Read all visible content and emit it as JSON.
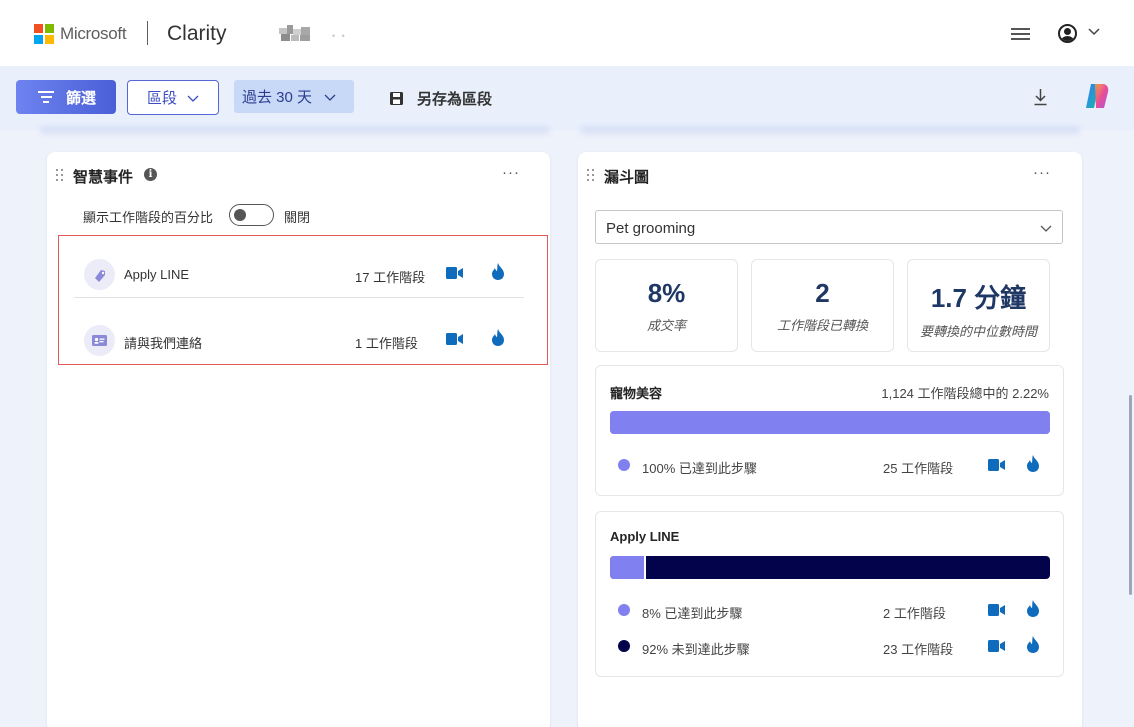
{
  "header": {
    "brand": "Microsoft",
    "product": "Clarity",
    "project_dots": "• •",
    "colors": {
      "ms_red": "#f25022",
      "ms_green": "#7fba00",
      "ms_blue": "#00a4ef",
      "ms_yellow": "#ffb900"
    }
  },
  "toolbar": {
    "filter_label": "篩選",
    "segment_label": "區段",
    "range_label": "過去 30 天",
    "save_label": "另存為區段"
  },
  "smart_events": {
    "title": "智慧事件",
    "more": "···",
    "toggle_label": "顯示工作階段的百分比",
    "toggle_state": "關閉",
    "toggle_on": false,
    "events": [
      {
        "name": "Apply LINE",
        "count": "17 工作階段",
        "icon": "tag-icon"
      },
      {
        "name": "請與我們連絡",
        "count": "1 工作階段",
        "icon": "contact-card-icon"
      }
    ]
  },
  "funnel": {
    "title": "漏斗圖",
    "more": "···",
    "selected": "Pet grooming",
    "kpis": [
      {
        "value": "8%",
        "label": "成交率"
      },
      {
        "value": "2",
        "label": "工作階段已轉換"
      },
      {
        "value": "1.7 分鐘",
        "label": "要轉換的中位數時間"
      }
    ],
    "steps": [
      {
        "name": "寵物美容",
        "total": "1,124 工作階段總中的 2.22%",
        "reached_fraction": 1.0,
        "rows": [
          {
            "text": "100% 已達到此步驟",
            "count": "25 工作階段",
            "color": "#8080f0"
          }
        ]
      },
      {
        "name": "Apply LINE",
        "reached_fraction": 0.08,
        "rows": [
          {
            "text": "8% 已達到此步驟",
            "count": "2 工作階段",
            "color": "#8080f0"
          },
          {
            "text": "92% 未到達此步驟",
            "count": "23 工作階段",
            "color": "#03034c"
          }
        ]
      }
    ]
  }
}
